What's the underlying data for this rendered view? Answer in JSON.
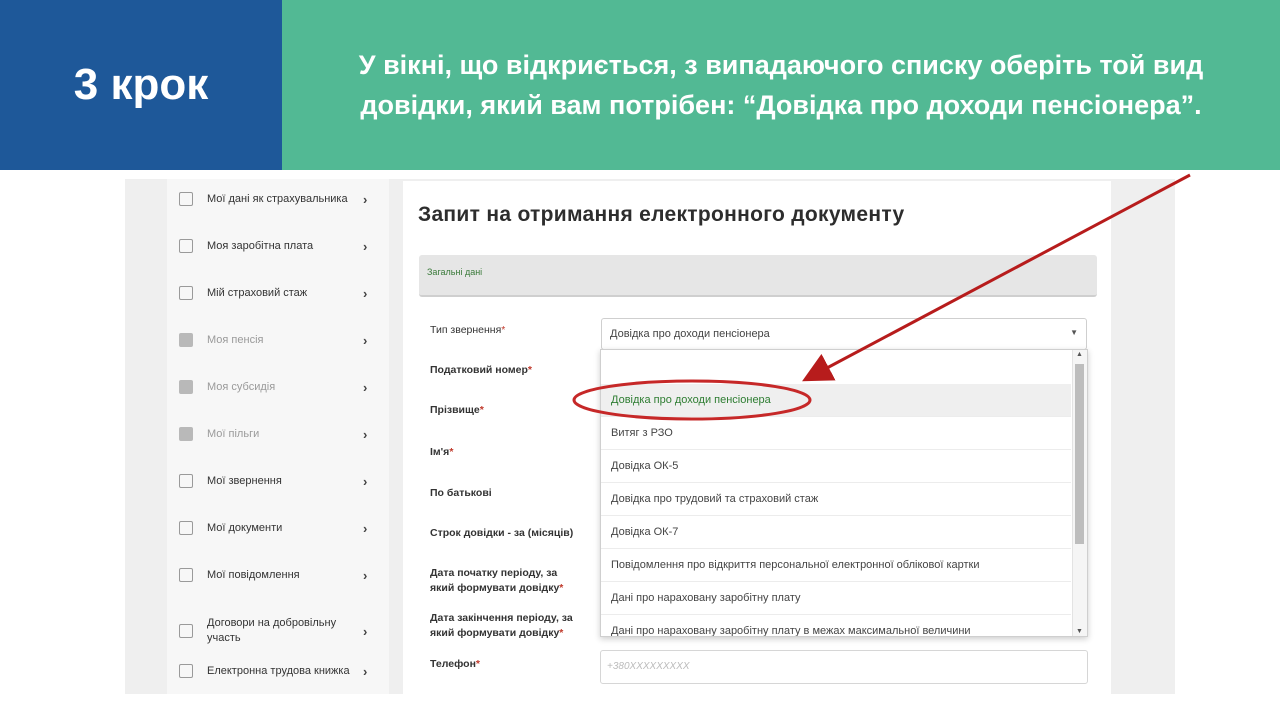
{
  "banner": {
    "step": "3 крок",
    "instruction_line1": "У вікні, що відкриється, з випадаючого списку оберіть той вид",
    "instruction_line2": "довідки, який вам потрібен: “Довідка про доходи пенсіонера”.",
    "colors": {
      "left": "#1e5899",
      "right": "#52b994"
    }
  },
  "sidebar": {
    "items": [
      {
        "label": "Мої дані як страхувальника",
        "icon": "document-icon"
      },
      {
        "label": "Моя заробітна плата",
        "icon": "wallet-icon"
      },
      {
        "label": "Мій страховий стаж",
        "icon": "calendar-icon"
      },
      {
        "label": "Моя пенсія",
        "icon": "folder-icon"
      },
      {
        "label": "Моя субсидія",
        "icon": "folder-icon"
      },
      {
        "label": "Мої пільги",
        "icon": "folder-icon"
      },
      {
        "label": "Мої звернення",
        "icon": "mail-icon"
      },
      {
        "label": "Мої документи",
        "icon": "document-icon"
      },
      {
        "label": "Мої повідомлення",
        "icon": "envelope-icon"
      },
      {
        "label": "Договори на добровільну участь",
        "icon": "envelope-icon"
      },
      {
        "label": "Електронна трудова книжка",
        "icon": "book-icon"
      }
    ],
    "chevron": "›"
  },
  "form": {
    "title": "Запит на отримання електронного документу",
    "section_label": "Загальні дані",
    "fields": {
      "request_type": "Тип звернення",
      "tax_number": "Податковий номер",
      "surname": "Прізвище",
      "name": "Ім'я",
      "patronymic": "По батькові",
      "duration": "Строк довідки - за (місяців)",
      "start_date": "Дата початку періоду, за який формувати довідку",
      "end_date": "Дата закінчення періоду, за який формувати довідку",
      "phone": "Телефон"
    },
    "required_mark": "*",
    "select_value": "Довідка про доходи пенсіонера",
    "phone_placeholder": "+380XXXXXXXXX",
    "dropdown_options": [
      "Довідка про доходи пенсіонера",
      "Витяг з РЗО",
      "Довідка ОК-5",
      "Довідка про трудовий та страховий стаж",
      "Довідка ОК-7",
      "Повідомлення про відкриття персональної електронної облікової картки",
      "Дані про нараховану заробітну плату",
      "Дані про нараховану заробітну плату в межах максимальної величини"
    ],
    "highlight_color": "#c62828"
  }
}
